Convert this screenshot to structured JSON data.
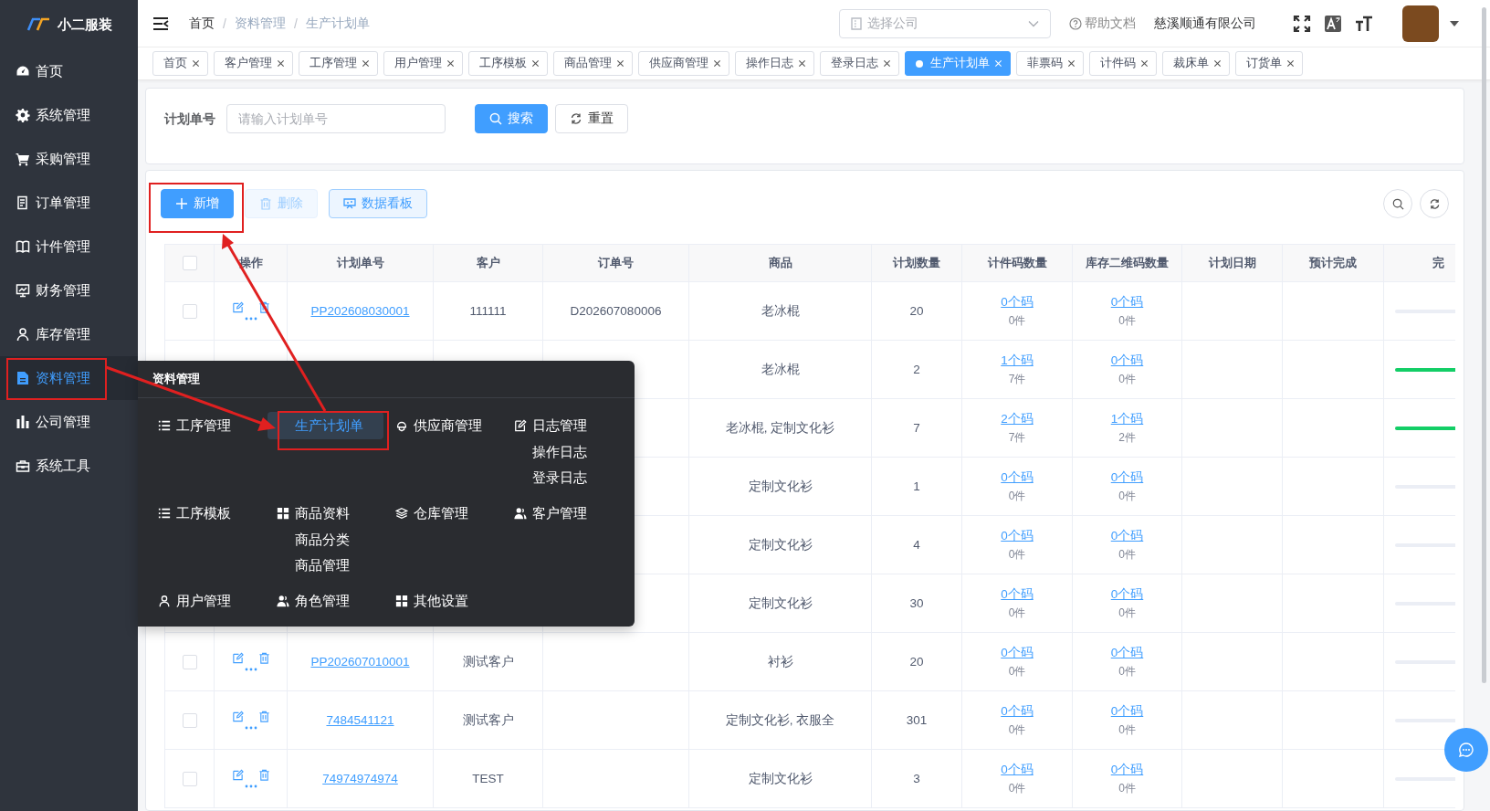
{
  "sidebar": {
    "brand": "小二服装",
    "items": [
      {
        "label": "首页",
        "kind": "dashboard",
        "selected": false
      },
      {
        "label": "系统管理",
        "kind": "gear",
        "selected": false
      },
      {
        "label": "采购管理",
        "kind": "cart",
        "selected": false
      },
      {
        "label": "订单管理",
        "kind": "order",
        "selected": false
      },
      {
        "label": "计件管理",
        "kind": "book",
        "selected": false
      },
      {
        "label": "财务管理",
        "kind": "board",
        "selected": false
      },
      {
        "label": "库存管理",
        "kind": "user",
        "selected": false
      },
      {
        "label": "资料管理",
        "kind": "doc",
        "selected": true
      },
      {
        "label": "公司管理",
        "kind": "bars",
        "selected": false
      },
      {
        "label": "系统工具",
        "kind": "toolbox",
        "selected": false
      }
    ]
  },
  "header": {
    "breadcrumb": [
      "首页",
      "资料管理",
      "生产计划单"
    ],
    "separator": "/",
    "company_select": {
      "placeholder": "选择公司"
    },
    "help": "帮助文档",
    "company": "慈溪顺通有限公司"
  },
  "tabs": [
    {
      "label": "首页",
      "selected": false
    },
    {
      "label": "客户管理",
      "selected": false
    },
    {
      "label": "工序管理",
      "selected": false
    },
    {
      "label": "用户管理",
      "selected": false
    },
    {
      "label": "工序模板",
      "selected": false
    },
    {
      "label": "商品管理",
      "selected": false
    },
    {
      "label": "供应商管理",
      "selected": false
    },
    {
      "label": "操作日志",
      "selected": false
    },
    {
      "label": "登录日志",
      "selected": false
    },
    {
      "label": "生产计划单",
      "selected": true
    },
    {
      "label": "菲票码",
      "selected": false
    },
    {
      "label": "计件码",
      "selected": false
    },
    {
      "label": "裁床单",
      "selected": false
    },
    {
      "label": "订货单",
      "selected": false
    }
  ],
  "search": {
    "label": "计划单号",
    "placeholder": "请输入计划单号",
    "search_button": "搜索",
    "reset_button": "重置"
  },
  "toolbar": {
    "add_button": "新增",
    "delete_button": {
      "label": "删除",
      "disabled": true
    },
    "dashboard_button": "数据看板"
  },
  "table": {
    "header_checked": false,
    "columns": [
      "操作",
      "计划单号",
      "客户",
      "订单号",
      "商品",
      "计划数量",
      "计件码数量",
      "库存二维码数量",
      "计划日期",
      "预计完成",
      "完"
    ],
    "rows": [
      {
        "checked": false,
        "plan_no": "PP202608030001",
        "customer": "111111",
        "order_no": "D202607080006",
        "product": "老冰棍",
        "qty": "20",
        "code_link": "0个码",
        "code_count": "0件",
        "stock_link": "0个码",
        "stock_count": "0件",
        "level": 0
      },
      {
        "product": "老冰棍",
        "qty": "2",
        "code_link": "1个码",
        "code_count": "7件",
        "stock_link": "0个码",
        "stock_count": "0件",
        "level": 1
      },
      {
        "product": "老冰棍, 定制文化衫",
        "qty": "7",
        "code_link": "2个码",
        "code_count": "7件",
        "stock_link": "1个码",
        "stock_count": "2件",
        "level": 1
      },
      {
        "product": "定制文化衫",
        "qty": "1",
        "code_link": "0个码",
        "code_count": "0件",
        "stock_link": "0个码",
        "stock_count": "0件",
        "level": 0
      },
      {
        "product": "定制文化衫",
        "qty": "4",
        "code_link": "0个码",
        "code_count": "0件",
        "stock_link": "0个码",
        "stock_count": "0件",
        "level": 0
      },
      {
        "product": "定制文化衫",
        "qty": "30",
        "code_link": "0个码",
        "code_count": "0件",
        "stock_link": "0个码",
        "stock_count": "0件",
        "level": 0
      },
      {
        "checked": false,
        "plan_no": "PP202607010001",
        "customer": "测试客户",
        "product": "衬衫",
        "qty": "20",
        "code_link": "0个码",
        "code_count": "0件",
        "stock_link": "0个码",
        "stock_count": "0件",
        "level": 0
      },
      {
        "checked": false,
        "plan_no": "7484541121",
        "customer": "测试客户",
        "product": "定制文化衫, 衣服全",
        "qty": "301",
        "code_link": "0个码",
        "code_count": "0件",
        "stock_link": "0个码",
        "stock_count": "0件",
        "level": 0
      },
      {
        "checked": false,
        "plan_no": "74974974974",
        "customer": "TEST",
        "product": "定制文化衫",
        "qty": "3",
        "code_link": "0个码",
        "code_count": "0件",
        "stock_link": "0个码",
        "stock_count": "0件",
        "level": 0
      }
    ]
  },
  "menu": {
    "title": "资料管理",
    "groups": [
      {
        "label": "工序管理",
        "kind": "list",
        "selected": false
      },
      {
        "label": "生产计划单",
        "kind": "none",
        "selected": true
      },
      {
        "label": "供应商管理",
        "kind": "supplier",
        "selected": false
      },
      {
        "label": "日志管理",
        "kind": "edit",
        "selected": false,
        "children": [
          "操作日志",
          "登录日志"
        ]
      },
      {
        "label": "工序模板",
        "kind": "list",
        "selected": false
      },
      {
        "label": "商品资料",
        "kind": "grid",
        "selected": false,
        "children": [
          "商品分类",
          "商品管理"
        ]
      },
      {
        "label": "仓库管理",
        "kind": "layers",
        "selected": false
      },
      {
        "label": "客户管理",
        "kind": "users",
        "selected": false
      },
      {
        "label": "用户管理",
        "kind": "user",
        "selected": false
      },
      {
        "label": "角色管理",
        "kind": "users",
        "selected": false
      },
      {
        "label": "其他设置",
        "kind": "grid",
        "selected": false
      }
    ]
  }
}
